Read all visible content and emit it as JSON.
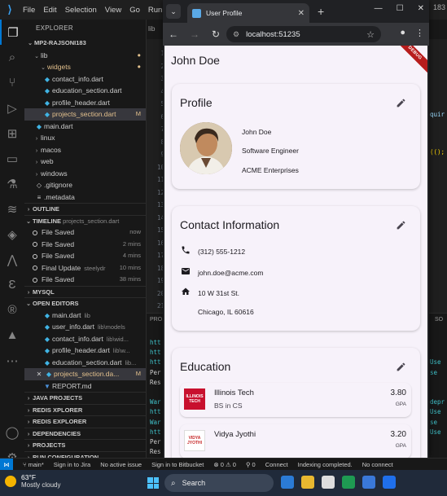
{
  "vscode": {
    "menu": [
      "File",
      "Edit",
      "Selection",
      "View",
      "Go",
      "Run",
      "T"
    ],
    "title_fragment": "183",
    "explorer_header": "EXPLORER",
    "project": "MP2-RAJSONI183",
    "tree": [
      {
        "label": "lib",
        "type": "folder"
      },
      {
        "label": "widgets",
        "type": "folder",
        "modified": true
      },
      {
        "label": "contact_info.dart",
        "type": "file"
      },
      {
        "label": "education_section.dart",
        "type": "file"
      },
      {
        "label": "profile_header.dart",
        "type": "file"
      },
      {
        "label": "projects_section.dart",
        "type": "file",
        "badge": "M"
      },
      {
        "label": "main.dart",
        "type": "file"
      },
      {
        "label": "linux",
        "type": "folder"
      },
      {
        "label": "macos",
        "type": "folder"
      },
      {
        "label": "web",
        "type": "folder"
      },
      {
        "label": "windows",
        "type": "folder"
      },
      {
        "label": ".gitignore",
        "type": "file"
      },
      {
        "label": ".metadata",
        "type": "file"
      }
    ],
    "outline": "OUTLINE",
    "timeline_header": "TIMELINE",
    "timeline_file": "projects_section.dart",
    "timeline": [
      {
        "label": "File Saved",
        "time": "now"
      },
      {
        "label": "File Saved",
        "time": "2 mins"
      },
      {
        "label": "File Saved",
        "time": "4 mins"
      },
      {
        "label": "Final Update",
        "meta": "steelydr",
        "time": "10 mins"
      },
      {
        "label": "File Saved",
        "time": "38 mins"
      }
    ],
    "mysql": "MYSQL",
    "open_editors_header": "OPEN EDITORS",
    "open_editors": [
      {
        "label": "main.dart",
        "meta": "lib"
      },
      {
        "label": "user_info.dart",
        "meta": "lib\\models"
      },
      {
        "label": "contact_info.dart",
        "meta": "lib\\wid..."
      },
      {
        "label": "profile_header.dart",
        "meta": "lib\\w..."
      },
      {
        "label": "education_section.dart",
        "meta": "lib..."
      },
      {
        "label": "projects_section.da...",
        "meta": "M"
      },
      {
        "label": "REPORT.md",
        "meta": ""
      }
    ],
    "sections": [
      "JAVA PROJECTS",
      "REDIS XPLORER",
      "REDIS EXPLORER",
      "DEPENDENCIES",
      "PROJECTS",
      "RUN CONFIGURATION"
    ],
    "tab_fragment": "lib",
    "line_numbers": [
      "1",
      "2",
      "3",
      "4",
      "5",
      "6",
      "7",
      "8",
      "9",
      "10",
      "11",
      "12",
      "13",
      "14",
      "15",
      "16",
      "17",
      "18",
      "19",
      "20",
      "21",
      "22"
    ],
    "code_right": [
      "",
      "",
      "",
      "",
      "",
      "quir",
      "",
      "",
      "(();"
    ],
    "panel_tab": "PRO",
    "panel_right_tab": "SO",
    "panel_lines": [
      "htt",
      "htt",
      "htt",
      "Per",
      "Res",
      "",
      "War",
      "htt",
      "War",
      "htt",
      "Per",
      "Res"
    ],
    "panel_right_lines": [
      "",
      "",
      "Use",
      "se",
      "",
      "",
      "depr",
      "Use",
      "se",
      "Use",
      "",
      ""
    ],
    "status": {
      "branch": "main*",
      "jira": "Sign in to Jira",
      "issue": "No active issue",
      "bitbucket": "Sign in to Bitbucket",
      "errors": "0",
      "warnings": "0",
      "ports": "0",
      "connect": "Connect",
      "indexing": "Indexing completed.",
      "noconn": "No connect"
    }
  },
  "browser": {
    "tab_title": "User Profile",
    "url": "localhost:51235"
  },
  "app": {
    "title": "John Doe",
    "debug_label": "DEBUG",
    "profile": {
      "title": "Profile",
      "name": "John Doe",
      "role": "Software Engineer",
      "company": "ACME Enterprises"
    },
    "contact": {
      "title": "Contact Information",
      "phone": "(312) 555-1212",
      "email": "john.doe@acme.com",
      "address_line1": "10 W 31st St.",
      "address_line2": "Chicago, IL 60616"
    },
    "education": {
      "title": "Education",
      "items": [
        {
          "school": "Illinois Tech",
          "degree": "BS in CS",
          "gpa": "3.80",
          "gpa_label": "GPA",
          "logo_text": "ILLINOIS TECH"
        },
        {
          "school": "Vidya Jyothi",
          "degree": "",
          "gpa": "3.20",
          "gpa_label": "GPA",
          "logo_text": "VIDYA JYOTHI"
        }
      ]
    }
  },
  "taskbar": {
    "temp": "63°F",
    "weather": "Mostly cloudy",
    "search": "Search"
  }
}
